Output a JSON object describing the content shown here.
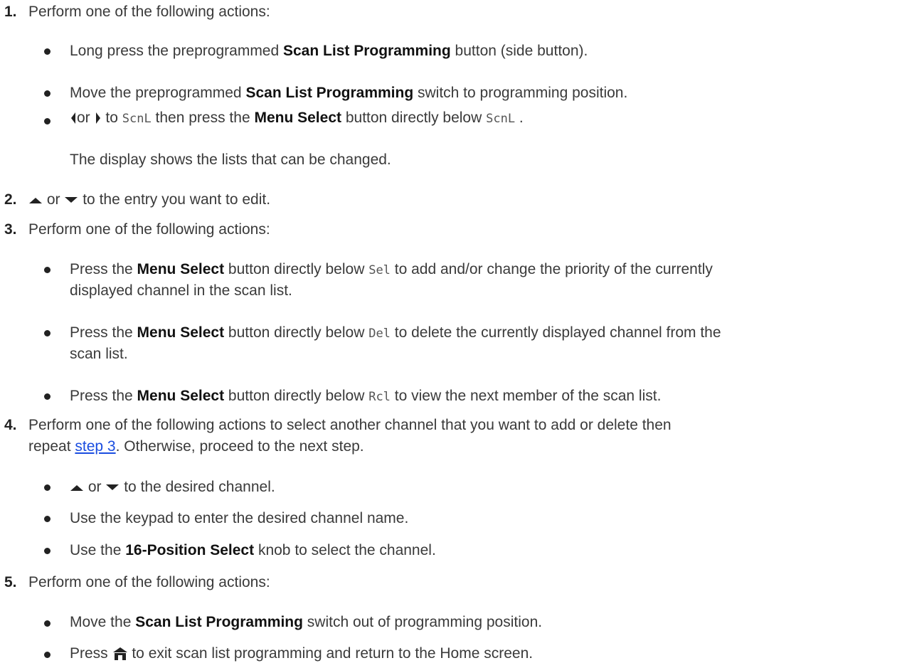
{
  "steps": [
    {
      "number": "1.",
      "text": "Perform one of the following actions:",
      "bullets": [
        {
          "pre": "Long press the preprogrammed ",
          "bold": "Scan List Programming",
          "post": " button (side button)."
        },
        {
          "pre": "Move the preprogrammed ",
          "bold": "Scan List Programming",
          "post": " switch to programming position."
        },
        {
          "or": "or",
          "to": "to",
          "mono1": "ScnL",
          "mid": "then press the ",
          "bold": "Menu Select",
          "mid2": " button directly below ",
          "mono2": "ScnL",
          "end": "."
        }
      ],
      "note": "The display shows the lists that can be changed."
    },
    {
      "number": "2.",
      "or": "or",
      "text": "to the entry you want to edit."
    },
    {
      "number": "3.",
      "text": "Perform one of the following actions:",
      "bullets": [
        {
          "pre": "Press the ",
          "bold": "Menu Select",
          "mid": " button directly below ",
          "mono": "Sel",
          "post": " to add and/or change the priority of the currently",
          "cont": "displayed channel in the scan list."
        },
        {
          "pre": "Press the ",
          "bold": "Menu Select",
          "mid": " button directly below ",
          "mono": "Del",
          "post": " to delete the currently displayed channel from the",
          "cont": "scan list."
        },
        {
          "pre": "Press the ",
          "bold": "Menu Select",
          "mid": " button directly below ",
          "mono": "Rcl",
          "post": " to view the next member of the scan list."
        }
      ]
    },
    {
      "number": "4.",
      "text": "Perform one of the following actions to select another channel that you want to add or delete then",
      "cont_pre": "repeat ",
      "link": "step 3",
      "cont_post": ". Otherwise, proceed to the next step.",
      "bullets": [
        {
          "or": "or",
          "post": "to the desired channel."
        },
        {
          "pre": "Use the keypad to enter the desired channel name."
        },
        {
          "pre": "Use the ",
          "bold": "16-Position Select",
          "post": " knob to select the channel."
        }
      ]
    },
    {
      "number": "5.",
      "text": "Perform one of the following actions:",
      "bullets": [
        {
          "pre": "Move the ",
          "bold": "Scan List Programming",
          "post": " switch out of programming position."
        },
        {
          "pre": "Press ",
          "post": " to exit scan list programming and return to the Home screen."
        }
      ]
    }
  ],
  "icons": {
    "left": "left-arrow-icon",
    "right": "right-arrow-icon",
    "up": "up-arrow-icon",
    "down": "down-arrow-icon",
    "home": "home-icon"
  },
  "colors": {
    "link": "#1a4de0",
    "text": "#3a3a3a"
  }
}
